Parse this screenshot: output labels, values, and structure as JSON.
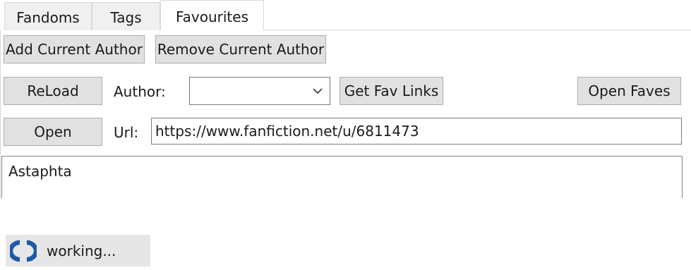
{
  "tabs": [
    {
      "label": "Fandoms"
    },
    {
      "label": "Tags"
    },
    {
      "label": "Favourites"
    }
  ],
  "active_tab": "Favourites",
  "toolbar": {
    "add_author_label": "Add Current Author",
    "remove_author_label": "Remove Current Author",
    "reload_label": "ReLoad",
    "author_label": "Author:",
    "author_value": "",
    "get_fav_links_label": "Get Fav Links",
    "open_faves_label": "Open Faves",
    "open_label": "Open",
    "url_label": "Url:",
    "url_value": "https://www.fanfiction.net/u/6811473"
  },
  "list": {
    "items": [
      "Astaphta"
    ]
  },
  "status": {
    "text": "working...",
    "icon": "refresh-icon",
    "icon_color": "#1c5aa6"
  },
  "colors": {
    "button_bg": "#e1e1e1",
    "button_border": "#adadad",
    "tab_bg": "#f0f0f0",
    "status_bg": "#e6e6e6"
  }
}
